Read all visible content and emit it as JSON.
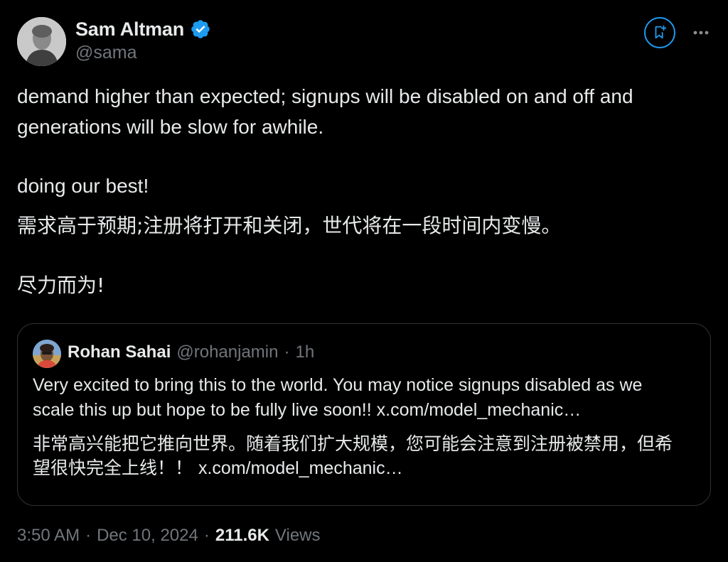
{
  "author": {
    "name": "Sam Altman",
    "handle": "@sama",
    "verified_icon": "verified-badge-icon",
    "badge_color": "#1d9bf0"
  },
  "actions": {
    "grok_icon": "grok-icon",
    "more_icon": "more-dots-icon"
  },
  "tweet": {
    "line1": "demand higher than expected; signups will be disabled on and off and",
    "line2": "generations will be slow for awhile.",
    "line3": "doing our best!",
    "line4": "需求高于预期;注册将打开和关闭，世代将在一段时间内变慢。",
    "line5": "尽力而为!"
  },
  "quote": {
    "name": "Rohan Sahai",
    "handle": "@rohanjamin",
    "separator": "·",
    "time": "1h",
    "line1": "Very excited to bring this to the world. You may notice signups disabled as we",
    "line2_text": "scale this up but hope to be fully live soon!!",
    "line2_link": "x.com/model_mechanic…",
    "line3": "非常高兴能把它推向世界。随着我们扩大规模，您可能会注意到注册被禁用，但希",
    "line4_text": "望很快完全上线！！",
    "line4_link": "x.com/model_mechanic…"
  },
  "footer": {
    "time": "3:50 AM",
    "sep1": "·",
    "date": "Dec 10, 2024",
    "sep2": "·",
    "views_count": "211.6K",
    "views_label": "Views"
  },
  "colors": {
    "background": "#000000",
    "text": "#e7e9ea",
    "muted": "#71767b",
    "accent": "#1d9bf0",
    "border": "#2f3336"
  }
}
